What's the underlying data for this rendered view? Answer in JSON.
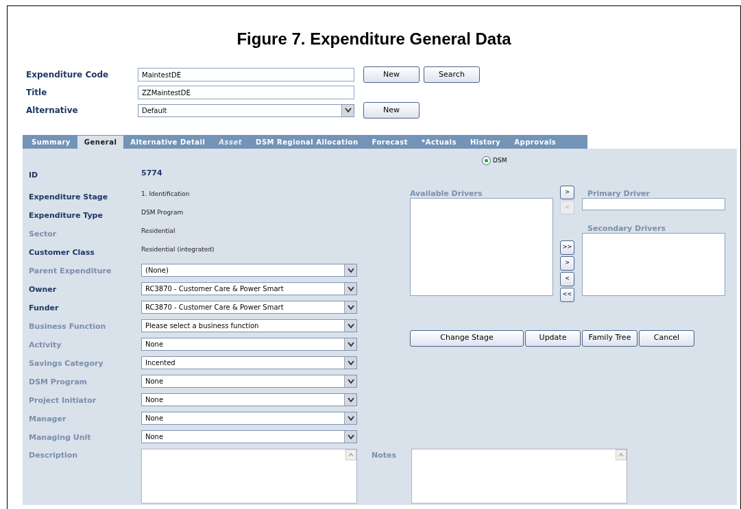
{
  "figure_title": "Figure 7. Expenditure General Data",
  "header": {
    "fields": [
      {
        "label": "Expenditure Code",
        "kind": "text",
        "value": "MaintestDE",
        "buttons": [
          "New",
          "Search"
        ]
      },
      {
        "label": "Title",
        "kind": "text",
        "value": "ZZMaintestDE"
      },
      {
        "label": "Alternative",
        "kind": "select",
        "value": "Default",
        "buttons": [
          "New"
        ]
      }
    ]
  },
  "tabs": [
    {
      "label": "Summary",
      "selected": false,
      "disabled": false
    },
    {
      "label": "General",
      "selected": true,
      "disabled": false
    },
    {
      "label": "Alternative Detail",
      "selected": false,
      "disabled": false
    },
    {
      "label": "Asset",
      "selected": false,
      "disabled": true
    },
    {
      "label": "DSM Regional Allocation",
      "selected": false,
      "disabled": false
    },
    {
      "label": "Forecast",
      "selected": false,
      "disabled": false
    },
    {
      "label": "*Actuals",
      "selected": false,
      "disabled": false
    },
    {
      "label": "History",
      "selected": false,
      "disabled": false
    },
    {
      "label": "Approvals",
      "selected": false,
      "disabled": false
    }
  ],
  "fields": [
    {
      "label": "ID",
      "kind": "id",
      "value": "5774",
      "required": true
    },
    {
      "label": "Expenditure Stage",
      "kind": "static",
      "value": "1. Identification",
      "required": true
    },
    {
      "label": "Expenditure Type",
      "kind": "static",
      "value": "DSM Program",
      "required": true
    },
    {
      "label": "Sector",
      "kind": "static",
      "value": "Residential",
      "required": false
    },
    {
      "label": "Customer Class",
      "kind": "static",
      "value": "Residential (integrated)",
      "required": true
    },
    {
      "label": "Parent Expenditure",
      "kind": "select",
      "value": "(None)",
      "required": false
    },
    {
      "label": "Owner",
      "kind": "select",
      "value": "RC3870 - Customer Care & Power Smart",
      "required": true
    },
    {
      "label": "Funder",
      "kind": "select",
      "value": "RC3870 - Customer Care & Power Smart",
      "required": true
    },
    {
      "label": "Business Function",
      "kind": "select",
      "value": "Please select a business function",
      "required": false
    },
    {
      "label": "Activity",
      "kind": "select",
      "value": "None",
      "required": false
    },
    {
      "label": "Savings Category",
      "kind": "select",
      "value": "Incented",
      "required": false
    },
    {
      "label": "DSM Program",
      "kind": "select",
      "value": "None",
      "required": false
    },
    {
      "label": "Project Initiator",
      "kind": "select",
      "value": "None",
      "required": false
    },
    {
      "label": "Manager",
      "kind": "select",
      "value": "None",
      "required": false
    },
    {
      "label": "Managing Unit",
      "kind": "select",
      "value": "None",
      "required": false
    }
  ],
  "radio": {
    "label": "DSM",
    "selected": true
  },
  "drivers": {
    "available_label": "Available Drivers",
    "primary_label": "Primary Driver",
    "secondary_label": "Secondary Drivers",
    "primary_buttons": [
      {
        "label": ">",
        "disabled": false
      },
      {
        "label": "<",
        "disabled": true
      }
    ],
    "secondary_buttons": [
      {
        "label": ">>",
        "disabled": false
      },
      {
        "label": ">",
        "disabled": false
      },
      {
        "label": "<",
        "disabled": false
      },
      {
        "label": "<<",
        "disabled": false
      }
    ]
  },
  "actions": [
    "Change Stage",
    "Update",
    "Family Tree",
    "Cancel"
  ],
  "description_label": "Description",
  "notes_label": "Notes"
}
